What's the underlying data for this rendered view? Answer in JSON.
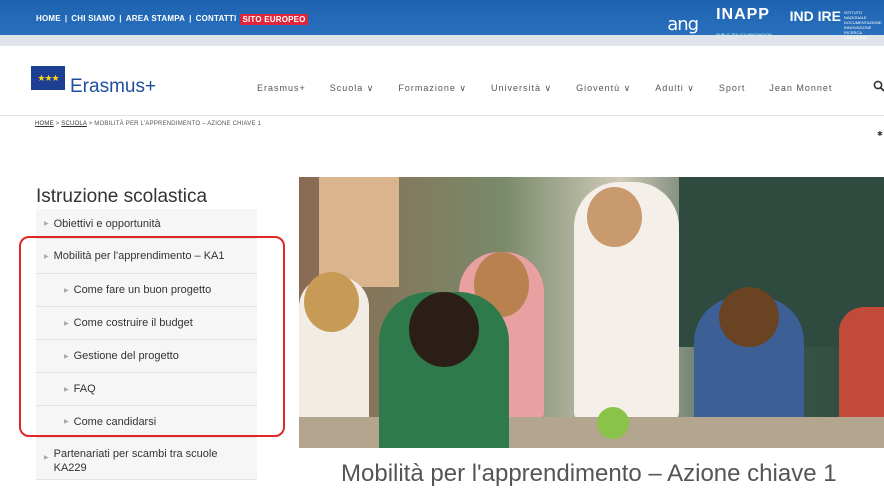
{
  "topbar": {
    "links": [
      "HOME",
      "CHI SIAMO",
      "AREA STAMPA",
      "CONTATTI"
    ],
    "separator": "|",
    "highlight_link": "SITO EUROPEO",
    "logos": {
      "ang": "ang",
      "inapp": "INAPP",
      "inapp_sub": "PUBLIC POLICY INNOVATION",
      "indire": "IND IRE",
      "indire_sub": "ISTITUTO NAZIONALE DOCUMENTAZIONE INNOVAZIONE RICERCA EDUCATIVA"
    }
  },
  "header": {
    "brand": "Erasmus+",
    "nav": [
      "Erasmus+",
      "Scuola ∨",
      "Formazione ∨",
      "Università ∨",
      "Gioventù ∨",
      "Adulti ∨",
      "Sport",
      "Jean Monnet"
    ],
    "search_icon": "search-icon"
  },
  "breadcrumb": {
    "home": "HOME",
    "scuola": "SCUOLA",
    "sep": " > ",
    "current": "MOBILITÀ PER L'APPRENDIMENTO – AZIONE CHIAVE 1"
  },
  "sidebar": {
    "title": "Istruzione scolastica",
    "items": [
      {
        "label": "Obiettivi e opportunità",
        "level": 1
      },
      {
        "label": "Mobilità per l'apprendimento – KA1",
        "level": 1
      },
      {
        "label": "Come fare un buon progetto",
        "level": 2
      },
      {
        "label": "Come costruire il budget",
        "level": 2
      },
      {
        "label": "Gestione del progetto",
        "level": 2
      },
      {
        "label": "FAQ",
        "level": 2
      },
      {
        "label": "Come candidarsi",
        "level": 2
      },
      {
        "label": "Partenariati per scambi tra scuole KA229",
        "level": 1
      }
    ]
  },
  "main": {
    "title": "Mobilità per l'apprendimento – Azione chiave 1"
  },
  "colors": {
    "topbar": "#1e63b0",
    "highlight": "#e0263b",
    "brand": "#1e4f9c",
    "annotation": "#e0262b"
  }
}
